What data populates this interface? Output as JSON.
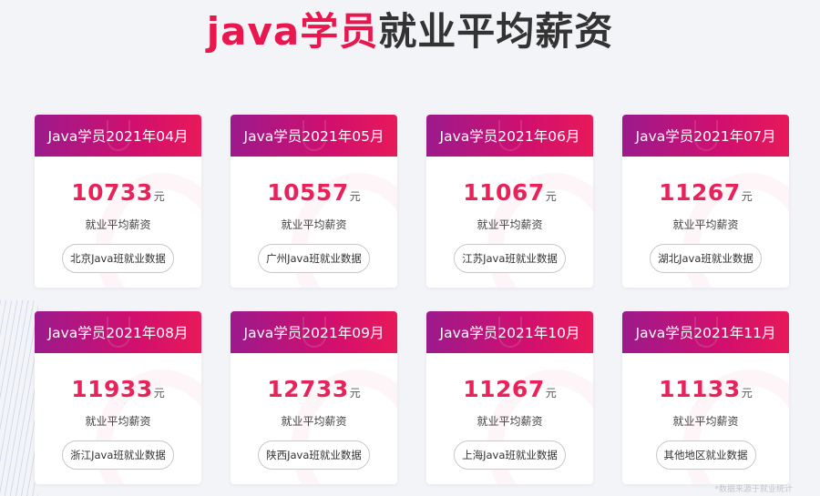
{
  "title": {
    "accent": "java学员",
    "rest": "就业平均薪资"
  },
  "unit": "元",
  "sublabel": "就业平均薪资",
  "cards": [
    {
      "period": "Java学员2021年04月",
      "salary": "10733",
      "button": "北京Java班就业数据"
    },
    {
      "period": "Java学员2021年05月",
      "salary": "10557",
      "button": "广州Java班就业数据"
    },
    {
      "period": "Java学员2021年06月",
      "salary": "11067",
      "button": "江苏Java班就业数据"
    },
    {
      "period": "Java学员2021年07月",
      "salary": "11267",
      "button": "湖北Java班就业数据"
    },
    {
      "period": "Java学员2021年08月",
      "salary": "11933",
      "button": "浙江Java班就业数据"
    },
    {
      "period": "Java学员2021年09月",
      "salary": "12733",
      "button": "陕西Java班就业数据"
    },
    {
      "period": "Java学员2021年10月",
      "salary": "11267",
      "button": "上海Java班就业数据"
    },
    {
      "period": "Java学员2021年11月",
      "salary": "11133",
      "button": "其他地区就业数据"
    }
  ],
  "footnote": "*数据来源于就业统计",
  "colors": {
    "accent": "#e8174e",
    "header_start": "#9c1a8c",
    "header_end": "#e8195a",
    "background": "#f3f4f8"
  }
}
